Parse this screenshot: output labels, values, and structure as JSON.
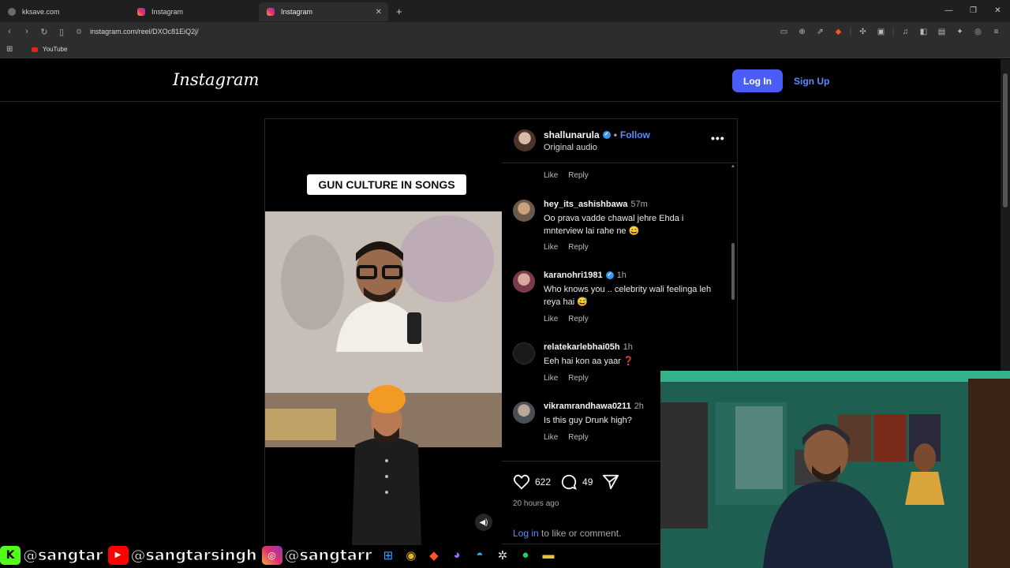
{
  "browser": {
    "tabs": [
      {
        "label": "kksave.com",
        "active": false
      },
      {
        "label": "Instagram",
        "active": false
      },
      {
        "label": "Instagram",
        "active": true
      }
    ],
    "url": "instagram.com/reel/DXOc81EiQ2j/",
    "bookmarks": [
      {
        "label": "YouTube"
      }
    ]
  },
  "instagram": {
    "logo": "Instagram",
    "login_button": "Log In",
    "signup_button": "Sign Up"
  },
  "post": {
    "headline": "GUN CULTURE IN SONGS",
    "author": "shallunarula",
    "follow_label": "Follow",
    "audio": "Original audio",
    "likes": "622",
    "comments_count": "49",
    "posted": "20 hours ago",
    "login_link": "Log in",
    "login_suffix": " to like or comment."
  },
  "comments": {
    "like_label": "Like",
    "reply_label": "Reply",
    "items": [
      {
        "user": "hey_its_ashishbawa",
        "time": "57m",
        "text": "Oo prava vadde chawal jehre Ehda i mnterview lai rahe ne 😄",
        "verified": false
      },
      {
        "user": "karanohri1981",
        "time": "1h",
        "text": "Who knows you .. celebrity wali feelinga leh reya hai 😅",
        "verified": true
      },
      {
        "user": "relatekarlebhai05h",
        "time": "1h",
        "text": "Eeh hai kon aa yaar ❓",
        "verified": false
      },
      {
        "user": "vikramrandhawa0211",
        "time": "2h",
        "text": "Is this guy Drunk high?",
        "verified": false
      }
    ]
  },
  "overlay": {
    "handles": [
      {
        "icon": "kick-icon",
        "text": "@sangtar"
      },
      {
        "icon": "youtube-icon",
        "text": "@sangtarsingh"
      },
      {
        "icon": "instagram-icon",
        "text": "@sangtarr"
      }
    ]
  },
  "colors": {
    "accent": "#4a5df9",
    "link": "#5b8cff",
    "background": "#000000"
  }
}
